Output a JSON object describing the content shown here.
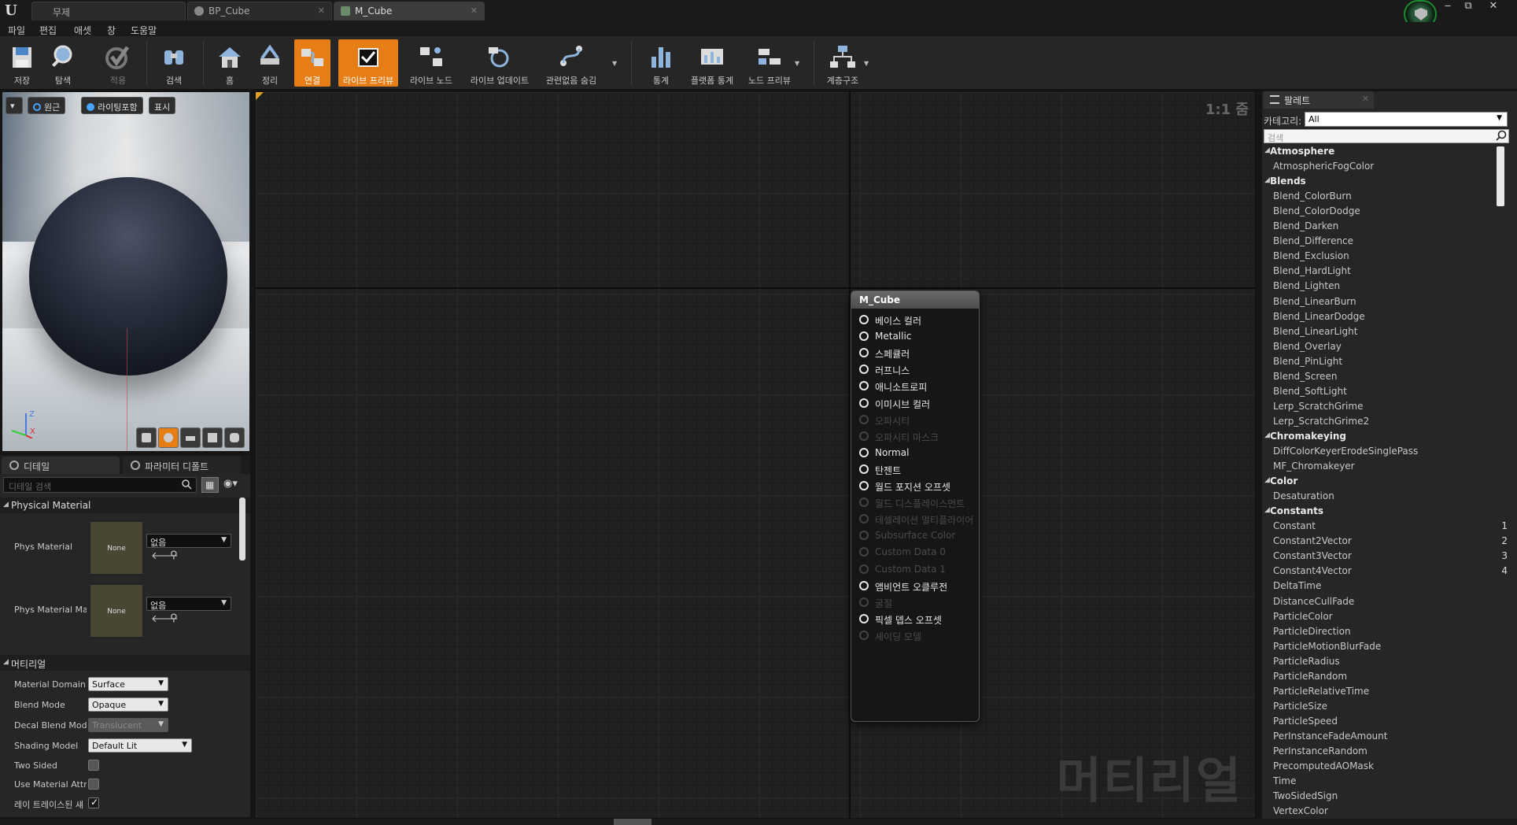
{
  "tabs": [
    {
      "label": "무제",
      "active": false
    },
    {
      "label": "BP_Cube",
      "active": false
    },
    {
      "label": "M_Cube",
      "active": true
    }
  ],
  "window_controls": {
    "minimize": "‒",
    "restore": "⧉",
    "close": "✕"
  },
  "menu": [
    "파일",
    "편집",
    "애셋",
    "창",
    "도움말"
  ],
  "toolbar": {
    "save": "저장",
    "browse": "탐색",
    "apply": "적용",
    "search": "검색",
    "home": "홈",
    "clean_up": "정리",
    "connectors": "연결",
    "live_preview": "라이브 프리뷰",
    "live_nodes": "라이브 노드",
    "live_update": "라이브 업데이트",
    "hide_unrelated": "관련없음 숨김",
    "stats": "통계",
    "platform_stats": "플랫폼 통계",
    "node_preview": "노드 프리뷰",
    "hierarchy": "계층구조"
  },
  "viewport": {
    "view_mode": "원근",
    "lighting": "라이팅포함",
    "show": "표시",
    "axis_z": "Z",
    "axis_x": "X"
  },
  "details": {
    "tab_details": "디테일",
    "tab_params": "파라미터 디폴트",
    "search_placeholder": "디테일 검색",
    "section_physical": "Physical Material",
    "phys_material_label": "Phys Material",
    "phys_material_mask_label": "Phys Material Ma",
    "thumb_none": "None",
    "none_option": "없음",
    "section_material": "머티리얼",
    "material_domain_label": "Material Domain",
    "material_domain_value": "Surface",
    "blend_mode_label": "Blend Mode",
    "blend_mode_value": "Opaque",
    "decal_blend_label": "Decal Blend Mode",
    "decal_blend_value": "Translucent",
    "shading_model_label": "Shading Model",
    "shading_model_value": "Default Lit",
    "two_sided_label": "Two Sided",
    "use_attr_label": "Use Material Attri",
    "raytraced_label": "레이 트레이스된 섀"
  },
  "graph": {
    "zoom": "1:1 줌",
    "watermark": "머티리얼",
    "node_title": "M_Cube",
    "pins": [
      {
        "label": "베이스 컬러",
        "enabled": true
      },
      {
        "label": "Metallic",
        "enabled": true
      },
      {
        "label": "스페큘러",
        "enabled": true
      },
      {
        "label": "러프니스",
        "enabled": true
      },
      {
        "label": "애니소트로피",
        "enabled": true
      },
      {
        "label": "이미시브 컬러",
        "enabled": true
      },
      {
        "label": "오파시티",
        "enabled": false
      },
      {
        "label": "오파시티 마스크",
        "enabled": false
      },
      {
        "label": "Normal",
        "enabled": true
      },
      {
        "label": "탄젠트",
        "enabled": true
      },
      {
        "label": "월드 포지션 오프셋",
        "enabled": true
      },
      {
        "label": "월드 디스플레이스먼트",
        "enabled": false
      },
      {
        "label": "테셀레이션 멀티플라이어",
        "enabled": false
      },
      {
        "label": "Subsurface Color",
        "enabled": false
      },
      {
        "label": "Custom Data 0",
        "enabled": false
      },
      {
        "label": "Custom Data 1",
        "enabled": false
      },
      {
        "label": "앰비언트 오클루전",
        "enabled": true
      },
      {
        "label": "굴절",
        "enabled": false
      },
      {
        "label": "픽셀 뎁스 오프셋",
        "enabled": true
      },
      {
        "label": "셰이딩 모델",
        "enabled": false
      }
    ]
  },
  "palette": {
    "tab": "팔레트",
    "category_label": "카테고리:",
    "category_value": "All",
    "search_placeholder": "검색",
    "rows": [
      {
        "label": "Atmosphere",
        "cat": true
      },
      {
        "label": "AtmosphericFogColor"
      },
      {
        "label": "Blends",
        "cat": true
      },
      {
        "label": "Blend_ColorBurn"
      },
      {
        "label": "Blend_ColorDodge"
      },
      {
        "label": "Blend_Darken"
      },
      {
        "label": "Blend_Difference"
      },
      {
        "label": "Blend_Exclusion"
      },
      {
        "label": "Blend_HardLight"
      },
      {
        "label": "Blend_Lighten"
      },
      {
        "label": "Blend_LinearBurn"
      },
      {
        "label": "Blend_LinearDodge"
      },
      {
        "label": "Blend_LinearLight"
      },
      {
        "label": "Blend_Overlay"
      },
      {
        "label": "Blend_PinLight"
      },
      {
        "label": "Blend_Screen"
      },
      {
        "label": "Blend_SoftLight"
      },
      {
        "label": "Lerp_ScratchGrime"
      },
      {
        "label": "Lerp_ScratchGrime2"
      },
      {
        "label": "Chromakeying",
        "cat": true
      },
      {
        "label": "DiffColorKeyerErodeSinglePass"
      },
      {
        "label": "MF_Chromakeyer"
      },
      {
        "label": "Color",
        "cat": true
      },
      {
        "label": "Desaturation"
      },
      {
        "label": "Constants",
        "cat": true
      },
      {
        "label": "Constant",
        "hotkey": "1"
      },
      {
        "label": "Constant2Vector",
        "hotkey": "2"
      },
      {
        "label": "Constant3Vector",
        "hotkey": "3"
      },
      {
        "label": "Constant4Vector",
        "hotkey": "4"
      },
      {
        "label": "DeltaTime"
      },
      {
        "label": "DistanceCullFade"
      },
      {
        "label": "ParticleColor"
      },
      {
        "label": "ParticleDirection"
      },
      {
        "label": "ParticleMotionBlurFade"
      },
      {
        "label": "ParticleRadius"
      },
      {
        "label": "ParticleRandom"
      },
      {
        "label": "ParticleRelativeTime"
      },
      {
        "label": "ParticleSize"
      },
      {
        "label": "ParticleSpeed"
      },
      {
        "label": "PerInstanceFadeAmount"
      },
      {
        "label": "PerInstanceRandom"
      },
      {
        "label": "PrecomputedAOMask"
      },
      {
        "label": "Time"
      },
      {
        "label": "TwoSidedSign"
      },
      {
        "label": "VertexColor"
      }
    ]
  },
  "colors": {
    "accent": "#e67e15",
    "source_control": "#1e8a30"
  }
}
